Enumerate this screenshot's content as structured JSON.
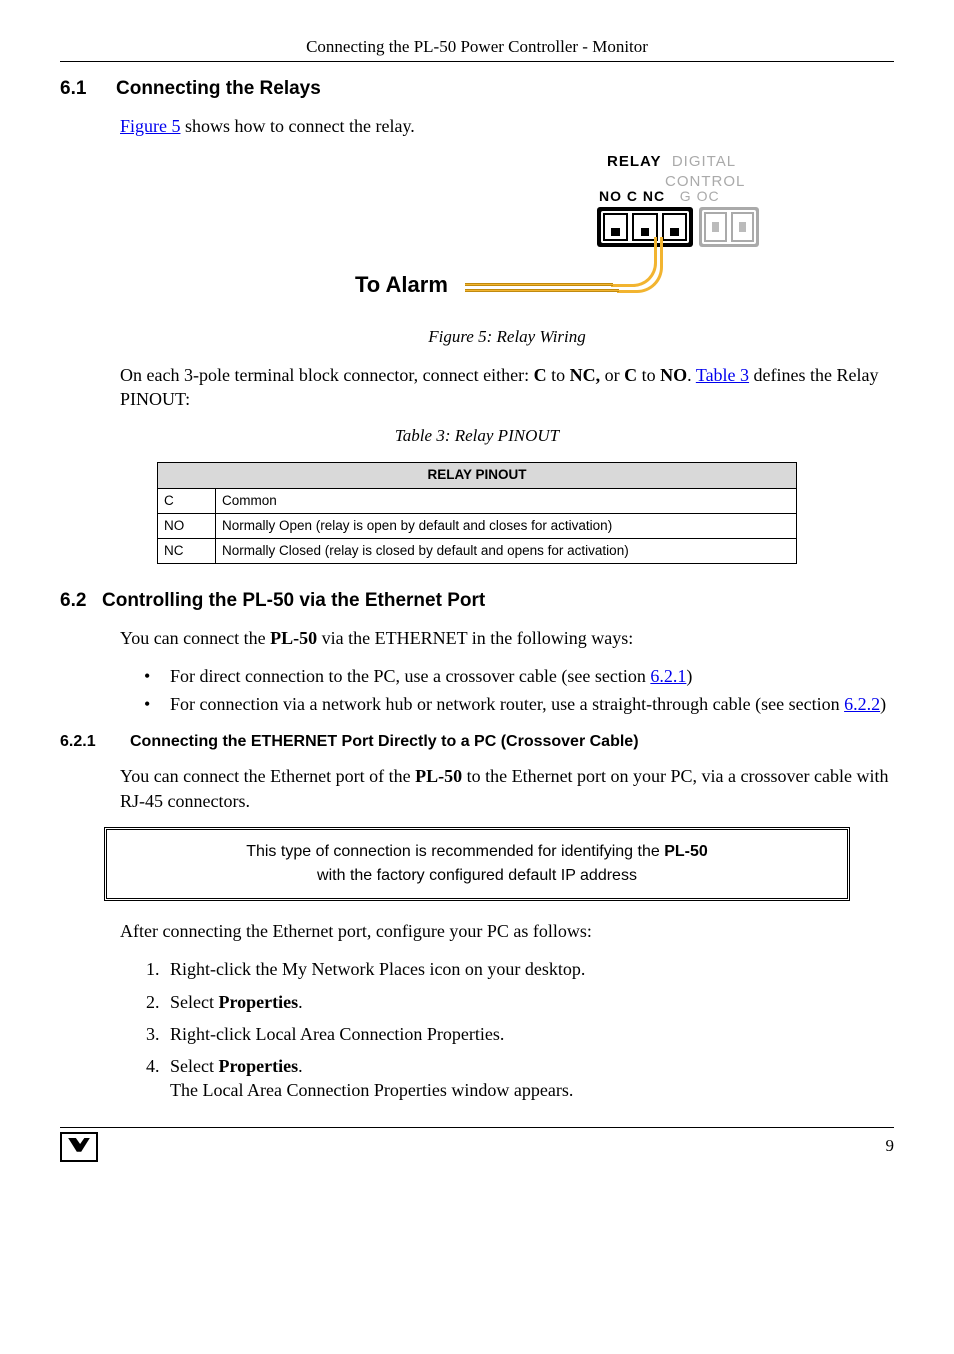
{
  "header": {
    "title": "Connecting the PL-50 Power Controller - Monitor"
  },
  "s61": {
    "num": "6.1",
    "title": "Connecting the Relays",
    "intro_pre": "",
    "intro_link": "Figure 5",
    "intro_post": " shows how to connect the relay."
  },
  "figure": {
    "alarm_label": "To Alarm",
    "relay_word": "RELAY",
    "digital_word": "DIGITAL",
    "control_word": "CONTROL",
    "labels_left": "NO C NC",
    "labels_right": "G OC",
    "caption": "Figure 5: Relay Wiring"
  },
  "after_fig": {
    "p_pre": "On each 3-pole terminal block connector, connect either: ",
    "c1": "C",
    "to1": " to ",
    "nc": "NC,",
    "or": " or ",
    "c2": "C",
    "to2": " to ",
    "no": "NO",
    "period": ". ",
    "link": "Table 3",
    "post": " defines the Relay PINOUT:"
  },
  "table": {
    "caption": "Table 3: Relay PINOUT",
    "header": "RELAY PINOUT",
    "rows": [
      {
        "code": "C",
        "desc": "Common"
      },
      {
        "code": "NO",
        "desc": "Normally Open (relay is open by default and closes for activation)"
      },
      {
        "code": "NC",
        "desc": "Normally Closed (relay is closed by default and opens for activation)"
      }
    ]
  },
  "s62": {
    "num": "6.2",
    "title": "Controlling the PL-50 via the Ethernet Port",
    "intro_pre": "You can connect the ",
    "intro_bold": "PL-50",
    "intro_post": " via the ETHERNET in the following ways:",
    "bullets": [
      {
        "pre": "For direct connection to the PC, use a crossover cable (see section ",
        "link": "6.2.1",
        "post": ")"
      },
      {
        "pre": "For connection via a network hub or network router, use a straight-through cable (see section ",
        "link": "6.2.2",
        "post": ")"
      }
    ]
  },
  "s621": {
    "num": "6.2.1",
    "title": "Connecting the ETHERNET Port Directly to a PC (Crossover Cable)",
    "p_pre": "You can connect the Ethernet port of the ",
    "p_bold": "PL-50",
    "p_post": " to the Ethernet port on your PC, via a crossover cable with RJ-45 connectors."
  },
  "callout": {
    "line1_pre": "This type of connection is recommended for identifying the ",
    "line1_bold": "PL-50",
    "line2": "with the factory configured default IP address"
  },
  "after_callout": "After connecting the Ethernet port, configure your PC as follows:",
  "steps": [
    {
      "text": "Right-click the My Network Places icon on your desktop."
    },
    {
      "pre": "Select ",
      "bold": "Properties",
      "post": "."
    },
    {
      "text": "Right-click Local Area Connection Properties."
    },
    {
      "pre": "Select ",
      "bold": "Properties",
      "post": ".",
      "cont": "The Local Area Connection Properties window appears."
    }
  ],
  "footer": {
    "page": "9"
  }
}
